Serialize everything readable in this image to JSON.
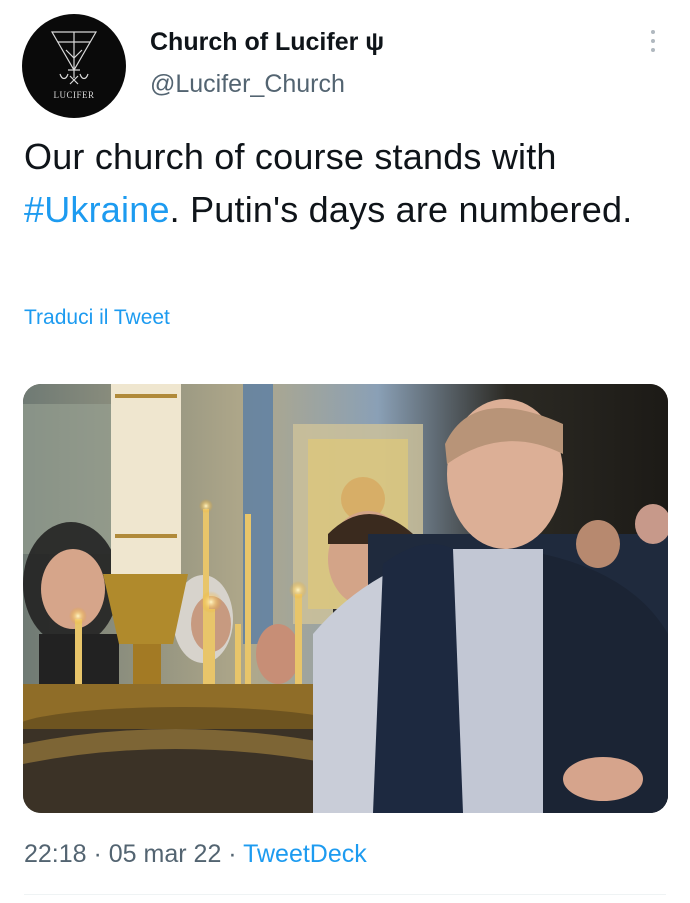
{
  "author": {
    "display_name": "Church of Lucifer ψ",
    "handle": "@Lucifer_Church",
    "avatar_caption": "LUCIFER"
  },
  "tweet": {
    "text_before": "Our church of course stands with ",
    "hashtag": "#Ukraine",
    "text_after": ". Putin's days are numbered.",
    "translate_link": "Traduci il Tweet"
  },
  "footer": {
    "time": "22:18",
    "separator1": " · ",
    "date": "05 mar 22",
    "separator2": " · ",
    "source": "TweetDeck"
  },
  "colors": {
    "accent": "#1d9bf0",
    "secondary_text": "#536471",
    "primary_text": "#0f1419"
  },
  "icons": {
    "more": "more-vertical-icon",
    "avatar_sigil": "sigil-of-lucifer-icon"
  }
}
